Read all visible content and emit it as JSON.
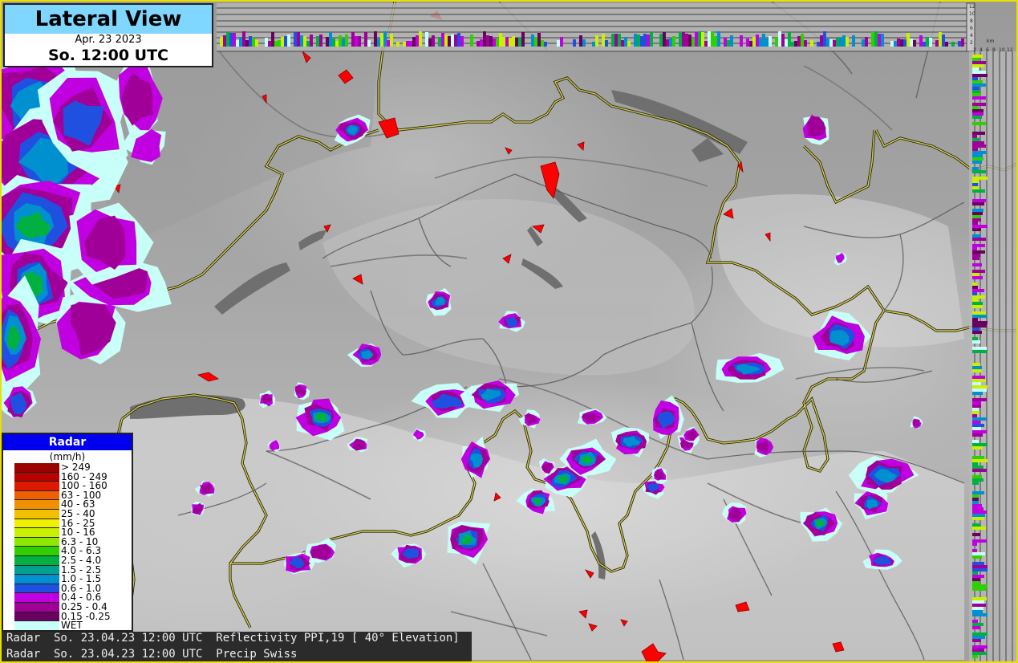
{
  "title": {
    "heading": "Lateral View",
    "date": "Apr. 23 2023",
    "time": "So. 12:00 UTC"
  },
  "legend": {
    "heading": "Radar",
    "unit": "(mm/h)",
    "classes": [
      {
        "label": "> 249",
        "color": "#9a0000"
      },
      {
        "label": "160 - 249",
        "color": "#b80000"
      },
      {
        "label": "100 - 160",
        "color": "#dd1a00"
      },
      {
        "label": "63 - 100",
        "color": "#f06000"
      },
      {
        "label": "40 - 63",
        "color": "#f09000"
      },
      {
        "label": "25 - 40",
        "color": "#f0c000"
      },
      {
        "label": "16 - 25",
        "color": "#f0f000"
      },
      {
        "label": "10 - 16",
        "color": "#c8f000"
      },
      {
        "label": "6.3 - 10",
        "color": "#90e800"
      },
      {
        "label": "4.0 - 6.3",
        "color": "#30d000"
      },
      {
        "label": "2.5 - 4.0",
        "color": "#00b040"
      },
      {
        "label": "1.5 - 2.5",
        "color": "#00a090"
      },
      {
        "label": "1.0 - 1.5",
        "color": "#0090d0"
      },
      {
        "label": "0.6 - 1.0",
        "color": "#2050e0"
      },
      {
        "label": "0.4 - 0.6",
        "color": "#c000e0"
      },
      {
        "label": "0.25 - 0.4",
        "color": "#a00098"
      },
      {
        "label": "0.15 -0.25",
        "color": "#6a0060"
      },
      {
        "label": "WET",
        "color": "#c8fff8"
      }
    ]
  },
  "footer": {
    "line1": "Radar  So. 23.04.23 12:00 UTC  Reflectivity PPI,19 [ 40° Elevation]",
    "line2": "Radar  So. 23.04.23 12:00 UTC  Precip Swiss"
  },
  "axes": {
    "top_ticks": [
      "12",
      "10",
      "8",
      "6",
      "4",
      "2"
    ],
    "top_unit": "km",
    "right_ticks": [
      "2",
      "4",
      "6",
      "8",
      "10",
      "12"
    ]
  }
}
